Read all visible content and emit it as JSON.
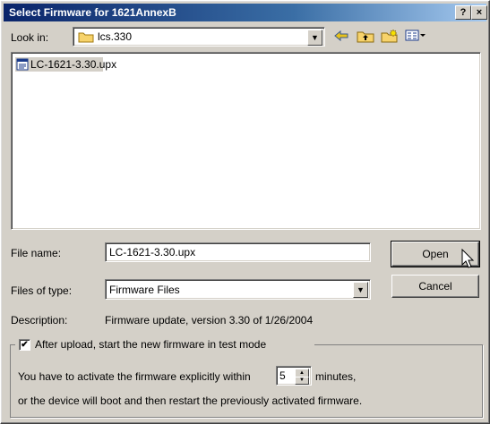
{
  "window": {
    "title": "Select Firmware for 1621AnnexB",
    "help_label": "?",
    "close_label": "×"
  },
  "lookin": {
    "label": "Look in:",
    "value": "lcs.330"
  },
  "toolbar": {
    "icons": [
      "back-arrow-icon",
      "up-folder-icon",
      "new-folder-icon",
      "view-menu-icon"
    ]
  },
  "files": [
    {
      "name": "LC-1621-3.30.upx"
    }
  ],
  "filename": {
    "label": "File name:",
    "value": "LC-1621-3.30.upx"
  },
  "filetype": {
    "label": "Files of type:",
    "value": "Firmware Files"
  },
  "buttons": {
    "open": "Open",
    "cancel": "Cancel"
  },
  "description": {
    "label": "Description:",
    "value": "Firmware update, version 3.30 of 1/26/2004"
  },
  "group": {
    "checkbox_label": "After upload, start the new firmware in test mode",
    "checked": true,
    "line1_prefix": "You have to activate the firmware explicitly within",
    "minutes_value": "5",
    "line1_suffix": "minutes,",
    "line2": "or the device will boot and then restart the previously activated firmware."
  },
  "colors": {
    "titlebar_start": "#0a246a",
    "titlebar_end": "#a6caf0",
    "selection": "#0a246a",
    "face": "#d4d0c8"
  }
}
